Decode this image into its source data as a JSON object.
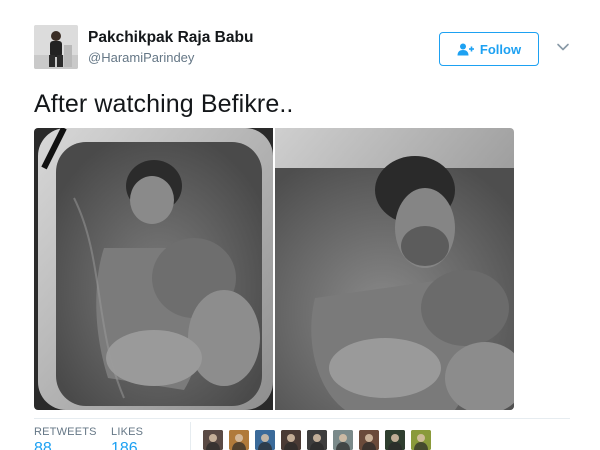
{
  "tweet": {
    "author_name": "Pakchikpak Raja Babu",
    "author_handle": "@HaramiParindey",
    "follow_label": "Follow",
    "text": "After watching Befikre.."
  },
  "stats": {
    "retweets_label": "RETWEETS",
    "retweets_value": "88",
    "likes_label": "LIKES",
    "likes_value": "186"
  },
  "colors": {
    "accent": "#1da1f2",
    "secondary_text": "#657786",
    "primary_text": "#14171a",
    "divider": "#e6ecf0"
  },
  "icons": {
    "follow": "follow-person-plus-icon",
    "menu": "chevron-down-icon"
  },
  "media": {
    "photo_count": 2
  },
  "liker_avatars": [
    {
      "color": "#5a4a44"
    },
    {
      "color": "#b07a3a"
    },
    {
      "color": "#3a6a9a"
    },
    {
      "color": "#4a3a34"
    },
    {
      "color": "#3d3d3d"
    },
    {
      "color": "#7a8a8a"
    },
    {
      "color": "#6a4a3a"
    },
    {
      "color": "#2f3f2f"
    },
    {
      "color": "#8a9a3a"
    }
  ]
}
